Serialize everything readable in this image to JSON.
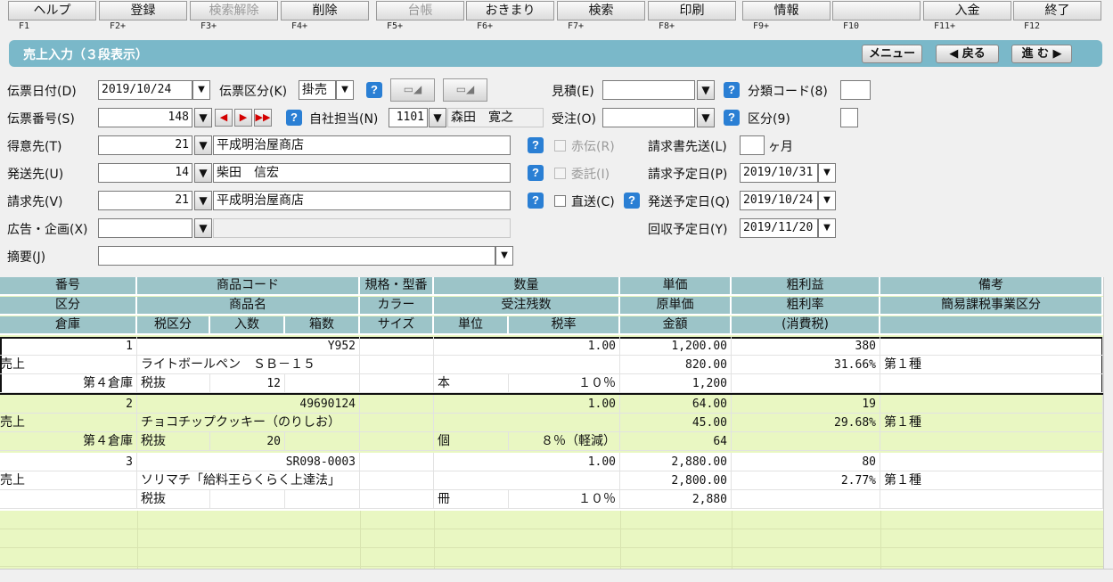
{
  "fkeys": [
    {
      "label": "ヘルプ",
      "key": "F1",
      "disabled": false
    },
    {
      "label": "登録",
      "key": "F2+",
      "disabled": false
    },
    {
      "label": "検索解除",
      "key": "F3+",
      "disabled": true
    },
    {
      "label": "削除",
      "key": "F4+",
      "disabled": false
    },
    {
      "label": "台帳",
      "key": "F5+",
      "disabled": true
    },
    {
      "label": "おきまり",
      "key": "F6+",
      "disabled": false
    },
    {
      "label": "検索",
      "key": "F7+",
      "disabled": false
    },
    {
      "label": "印刷",
      "key": "F8+",
      "disabled": false
    },
    {
      "label": "情報",
      "key": "F9+",
      "disabled": false
    },
    {
      "label": "",
      "key": "F10",
      "disabled": false
    },
    {
      "label": "入金",
      "key": "F11+",
      "disabled": false
    },
    {
      "label": "終了",
      "key": "F12",
      "disabled": false
    }
  ],
  "titlebar": {
    "title": "売上入力（３段表示）",
    "menu": "メニュー",
    "back": "◀ 戻る",
    "forward": "進 む ▶"
  },
  "form": {
    "date_label": "伝票日付(D)",
    "date_value": "2019/10/24",
    "kubun_label": "伝票区分(K)",
    "kubun_value": "掛売",
    "number_label": "伝票番号(S)",
    "number_value": "148",
    "staff_label": "自社担当(N)",
    "staff_code": "1101",
    "staff_name": "森田　寛之",
    "customer_label": "得意先(T)",
    "customer_code": "21",
    "customer_name": "平成明治屋商店",
    "ship_label": "発送先(U)",
    "ship_code": "14",
    "ship_name": "柴田　信宏",
    "bill_label": "請求先(V)",
    "bill_code": "21",
    "bill_name": "平成明治屋商店",
    "ad_label": "広告・企画(X)",
    "ad_code": "",
    "memo_label": "摘要(J)",
    "memo_value": "",
    "estimate_label": "見積(E)",
    "estimate_value": "",
    "order_label": "受注(O)",
    "order_value": "",
    "class_code_label": "分類コード(8)",
    "class_label": "区分(9)",
    "red_label": "赤伝(R)",
    "consign_label": "委託(I)",
    "direct_label": "直送(C)",
    "invoice_label": "請求書先送(L)",
    "invoice_unit": "ヶ月",
    "bill_date_label": "請求予定日(P)",
    "bill_date": "2019/10/31",
    "ship_date_label": "発送予定日(Q)",
    "ship_date": "2019/10/24",
    "collect_date_label": "回収予定日(Y)",
    "collect_date": "2019/11/20"
  },
  "grid": {
    "header1": [
      "番号",
      "商品コード",
      "規格・型番",
      "数量",
      "単価",
      "粗利益",
      "備考"
    ],
    "header2": [
      "区分",
      "商品名",
      "カラー",
      "受注残数",
      "原単価",
      "粗利率",
      "簡易課税事業区分"
    ],
    "header3": [
      "倉庫",
      "税区分",
      "入数",
      "箱数",
      "サイズ",
      "単位",
      "税率",
      "金額",
      "(消費税)",
      ""
    ],
    "records": [
      {
        "no": "1",
        "code": "Y952",
        "qty": "1.00",
        "price": "1,200.00",
        "profit": "380",
        "kubun": "売上",
        "name": "ライトボールペン　ＳＢ－１５",
        "cost": "820.00",
        "rate": "31.66%",
        "biz": "第１種",
        "warehouse": "第４倉庫",
        "tax": "税抜",
        "irisu": "12",
        "unit": "本",
        "taxrate": "１０％",
        "amount": "1,200"
      },
      {
        "no": "2",
        "code": "49690124",
        "qty": "1.00",
        "price": "64.00",
        "profit": "19",
        "kubun": "売上",
        "name": "チョコチップクッキー（のりしお）",
        "cost": "45.00",
        "rate": "29.68%",
        "biz": "第１種",
        "warehouse": "第４倉庫",
        "tax": "税抜",
        "irisu": "20",
        "unit": "個",
        "taxrate": "８％（軽減）",
        "amount": "64"
      },
      {
        "no": "3",
        "code": "SR098-0003",
        "qty": "1.00",
        "price": "2,880.00",
        "profit": "80",
        "kubun": "売上",
        "name": "ソリマチ「給料王らくらく上達法」",
        "cost": "2,800.00",
        "rate": "2.77%",
        "biz": "第１種",
        "warehouse": "",
        "tax": "税抜",
        "irisu": "",
        "unit": "冊",
        "taxrate": "１０％",
        "amount": "2,880"
      }
    ]
  }
}
